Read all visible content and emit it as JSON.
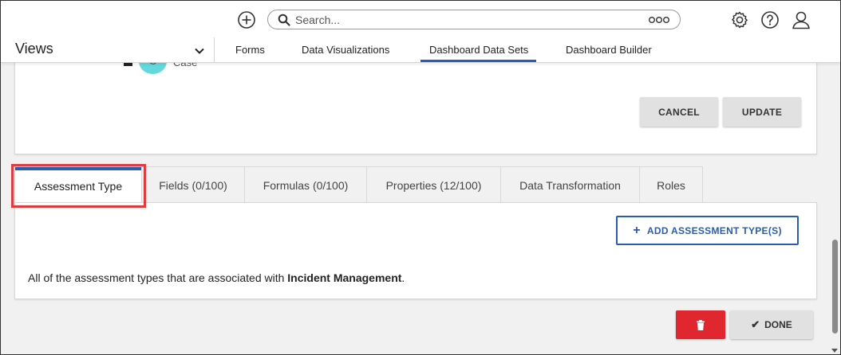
{
  "header": {
    "search_placeholder": "Search...",
    "icons": [
      "add-circle-icon",
      "search-icon",
      "more-icon",
      "gear-icon",
      "help-icon",
      "user-icon"
    ]
  },
  "nav": {
    "views_label": "Views",
    "tabs": [
      "Forms",
      "Data Visualizations",
      "Dashboard Data Sets",
      "Dashboard Builder"
    ],
    "active_tab": "Dashboard Data Sets"
  },
  "upper_card": {
    "avatar_letter": "C",
    "case_label": "Case",
    "cancel_label": "CANCEL",
    "update_label": "UPDATE"
  },
  "tabs": {
    "items": [
      "Assessment Type",
      "Fields (0/100)",
      "Formulas (0/100)",
      "Properties (12/100)",
      "Data Transformation",
      "Roles"
    ],
    "active": "Assessment Type"
  },
  "content": {
    "add_label": "ADD ASSESSMENT TYPE(S)",
    "desc_prefix": "All of the assessment types that are associated with ",
    "desc_bold": "Incident Management",
    "desc_suffix": "."
  },
  "footer": {
    "done_label": "DONE"
  },
  "colors": {
    "accent": "#2a5db0",
    "danger": "#e0262f",
    "highlight": "#e03c40",
    "avatar": "#63d8dd"
  }
}
